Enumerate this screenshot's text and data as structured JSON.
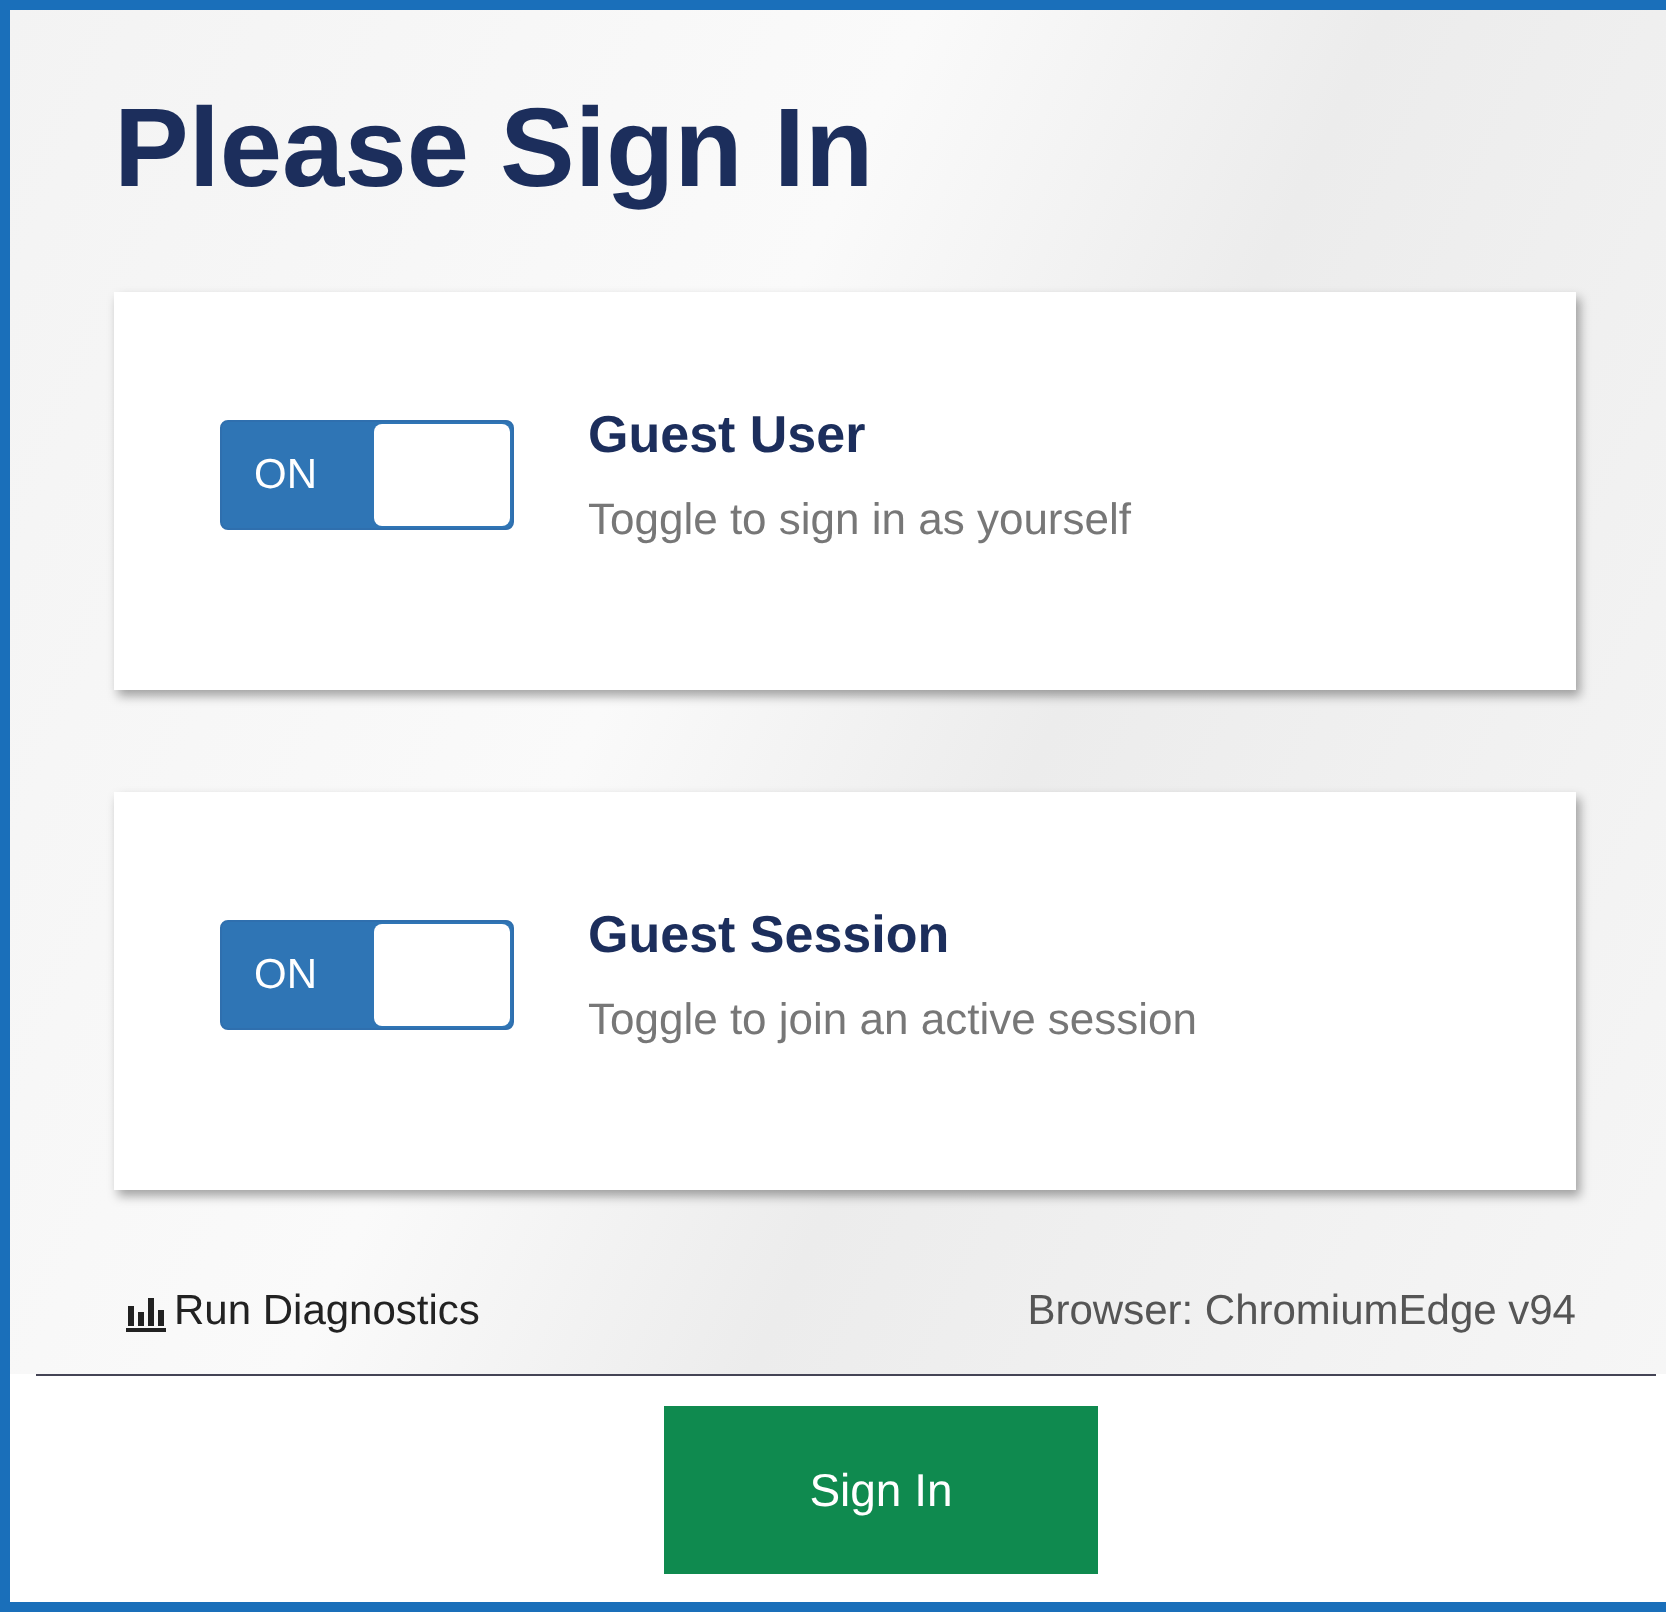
{
  "title": "Please Sign In",
  "options": [
    {
      "toggle_label": "ON",
      "on": true,
      "heading": "Guest User",
      "description": "Toggle to sign in as yourself"
    },
    {
      "toggle_label": "ON",
      "on": true,
      "heading": "Guest Session",
      "description": "Toggle to join an active session"
    }
  ],
  "footer": {
    "diagnostics_link": "Run Diagnostics",
    "browser_info": "Browser: ChromiumEdge v94"
  },
  "sign_in_button": "Sign In"
}
